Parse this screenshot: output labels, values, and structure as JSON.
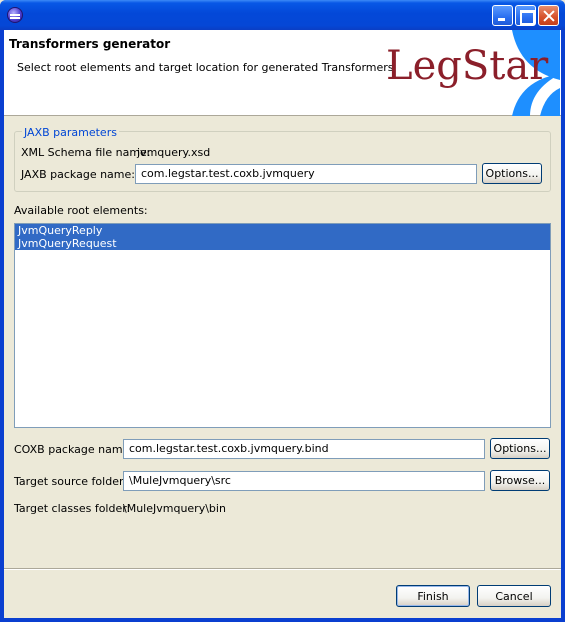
{
  "window": {
    "title": ""
  },
  "banner": {
    "title": "Transformers generator",
    "description": "Select root elements and target location for generated Transformers",
    "logo_text": "LegStar",
    "logo_color": "#8b1f2a",
    "logo_accent_color": "#1e90ff"
  },
  "jaxb": {
    "legend": "JAXB parameters",
    "schema_label": "XML Schema file name:",
    "schema_value": "jvmquery.xsd",
    "package_label": "JAXB package name:",
    "package_value": "com.legstar.test.coxb.jvmquery",
    "options_label": "Options..."
  },
  "root_elements": {
    "label": "Available root elements:",
    "items": [
      {
        "label": "JvmQueryReply",
        "selected": true
      },
      {
        "label": "JvmQueryRequest",
        "selected": true
      }
    ]
  },
  "coxb": {
    "package_label": "COXB package name:",
    "package_value": "com.legstar.test.coxb.jvmquery.bind",
    "options_label": "Options..."
  },
  "target": {
    "source_label": "Target source folder:",
    "source_value": "\\MuleJvmquery\\src",
    "browse_label": "Browse...",
    "classes_label": "Target classes folder:",
    "classes_value": "\\MuleJvmquery\\bin"
  },
  "footer": {
    "finish_label": "Finish",
    "cancel_label": "Cancel"
  },
  "colors": {
    "titlebar": "#0548d8",
    "selection": "#316ac5",
    "dialog_bg": "#ece9d8",
    "group_legend": "#0046d5"
  }
}
